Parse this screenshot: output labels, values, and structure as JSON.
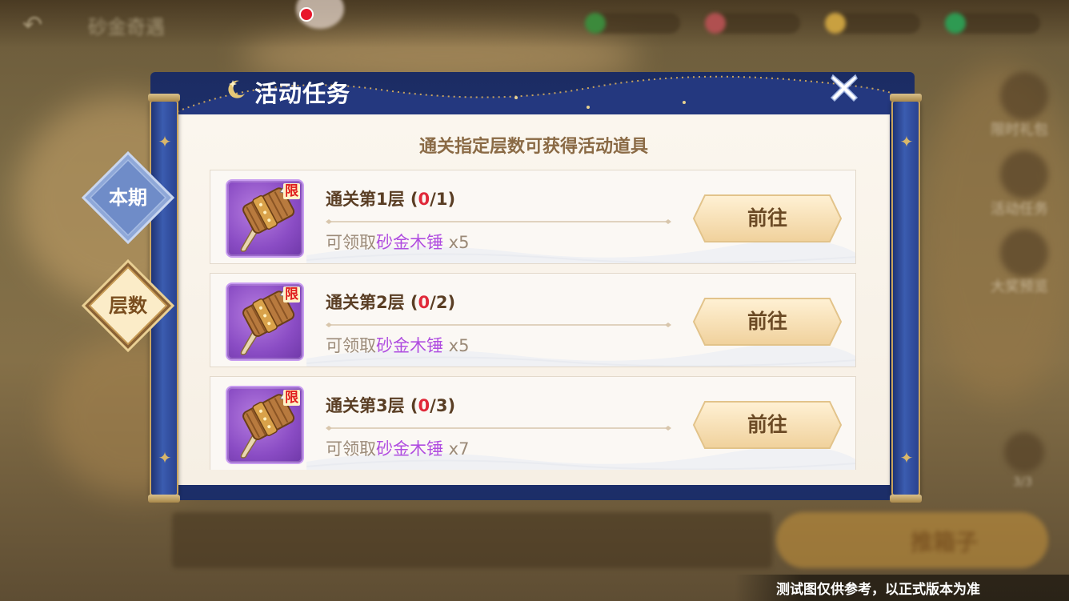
{
  "background": {
    "title": "砂金奇遇",
    "side_labels": [
      "限时礼包",
      "活动任务",
      "大奖预览"
    ],
    "side_counter": "3/3",
    "big_button": "推箱子"
  },
  "dialog": {
    "title": "活动任务",
    "subtitle": "通关指定层数可获得活动道具"
  },
  "tabs": [
    {
      "label": "本期",
      "selected": false
    },
    {
      "label": "层数",
      "selected": true
    }
  ],
  "tasks": [
    {
      "title": "通关第1层",
      "open": " (",
      "current": "0",
      "total": "/1)",
      "reward_prefix": "可领取",
      "item_name": "砂金木锤",
      "quantity": " x5",
      "badge": "限",
      "button": "前往"
    },
    {
      "title": "通关第2层",
      "open": " (",
      "current": "0",
      "total": "/2)",
      "reward_prefix": "可领取",
      "item_name": "砂金木锤",
      "quantity": " x5",
      "badge": "限",
      "button": "前往"
    },
    {
      "title": "通关第3层",
      "open": " (",
      "current": "0",
      "total": "/3)",
      "reward_prefix": "可领取",
      "item_name": "砂金木锤",
      "quantity": " x7",
      "badge": "限",
      "button": "前往"
    }
  ],
  "disclaimer": "测试图仅供参考，以正式版本为准",
  "colors": {
    "dialog_blue": "#1f3476",
    "paper": "#f8f2e8",
    "progress_red": "#e0293a",
    "item_purple": "#b04ee0",
    "button_gold": "#f3d9ab"
  }
}
